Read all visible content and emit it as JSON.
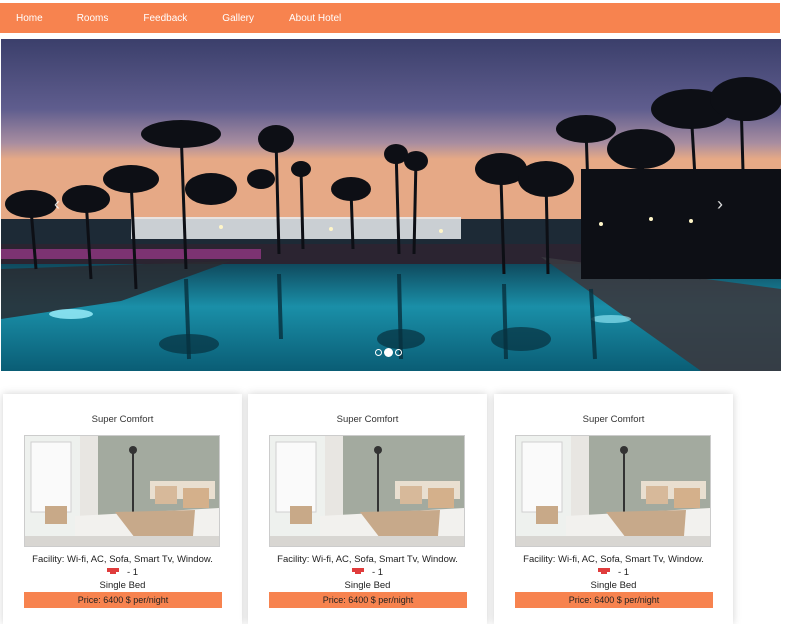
{
  "nav": {
    "items": [
      "Home",
      "Rooms",
      "Feedback",
      "Gallery",
      "About Hotel"
    ]
  },
  "colors": {
    "accent": "#f7834f"
  },
  "carousel": {
    "prev_icon": "chevron-left-icon",
    "next_icon": "chevron-right-icon",
    "slide_count": 3,
    "active_slide": 2
  },
  "rooms": [
    {
      "title": "Super Comfort",
      "facility": "Facility: Wi-fi, AC, Sofa, Smart Tv, Window.",
      "guests": "- 1",
      "bed": "Single  Bed",
      "price": "Price: 6400 $ per/night"
    },
    {
      "title": "Super Comfort",
      "facility": "Facility: Wi-fi, AC, Sofa, Smart Tv, Window.",
      "guests": "- 1",
      "bed": "Single  Bed",
      "price": "Price: 6400 $ per/night"
    },
    {
      "title": "Super Comfort",
      "facility": "Facility: Wi-fi, AC, Sofa, Smart Tv, Window.",
      "guests": "- 1",
      "bed": "Single  Bed",
      "price": "Price: 6400 $ per/night"
    }
  ]
}
